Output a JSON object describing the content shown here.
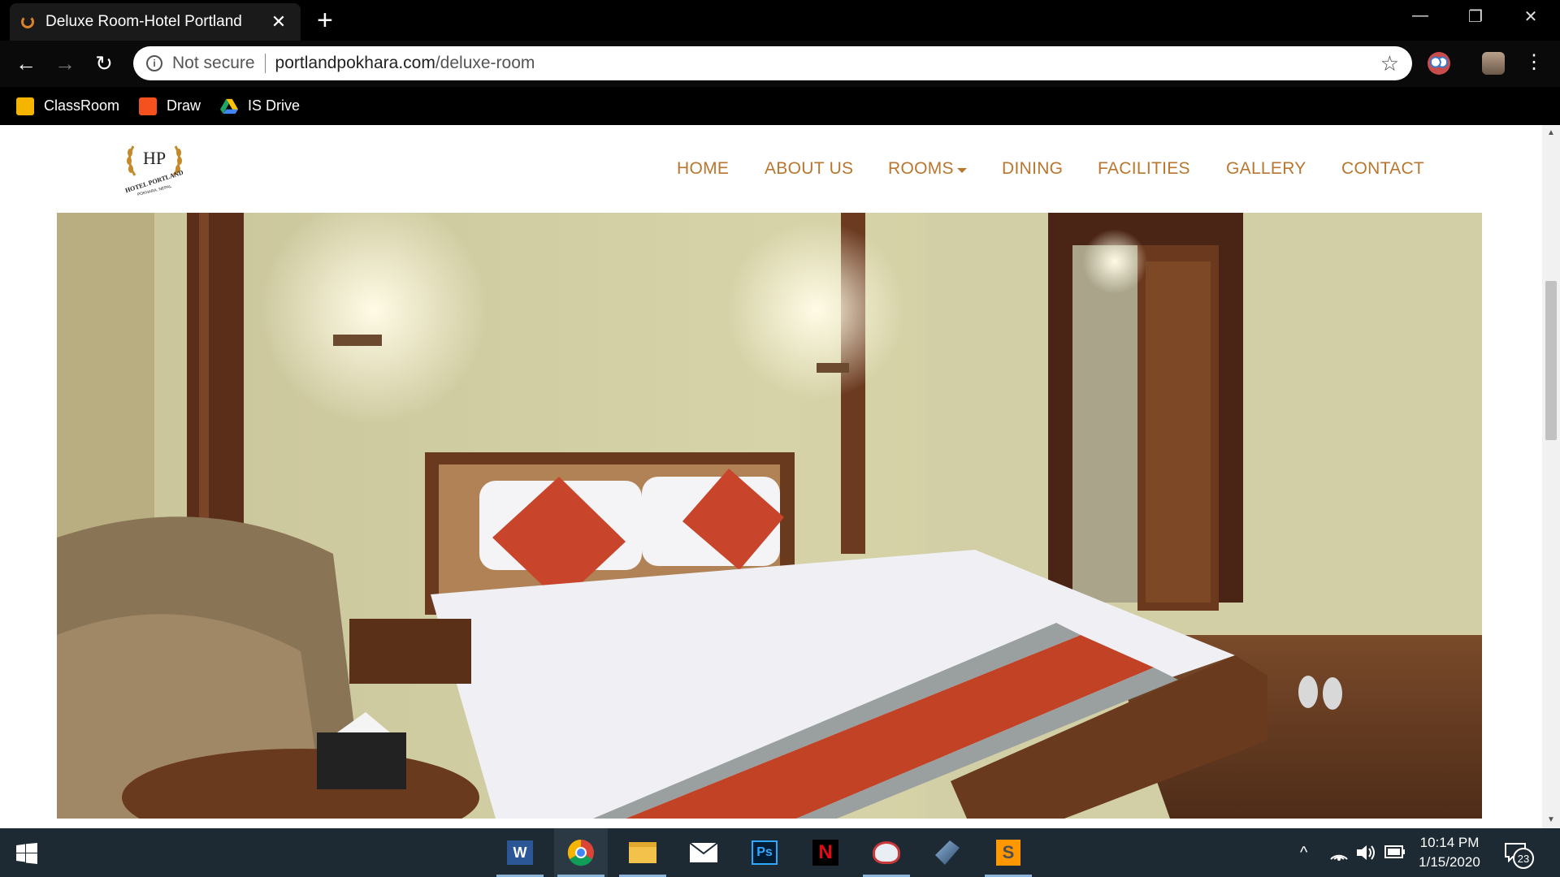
{
  "browser": {
    "tab_title": "Deluxe Room-Hotel Portland",
    "tab_close": "✕",
    "new_tab": "+",
    "window_controls": {
      "minimize": "—",
      "restore": "❐",
      "close": "✕"
    },
    "back": "←",
    "forward": "→",
    "reload": "↻",
    "security_label": "Not secure",
    "url_host": "portlandpokhara.com",
    "url_path": "/deluxe-room",
    "bookmark_star": "☆",
    "menu": "⋮",
    "bookmarks": [
      {
        "label": "ClassRoom",
        "icon": "google-classroom-icon",
        "color": "#f4b400"
      },
      {
        "label": "Draw",
        "icon": "draw-icon",
        "color": "#f4511e"
      },
      {
        "label": "IS Drive",
        "icon": "google-drive-icon",
        "color": "#1fa463"
      }
    ]
  },
  "site": {
    "logo_initials": "HP",
    "logo_name": "HOTEL PORTLAND",
    "logo_place": "POKHARA, NEPAL",
    "nav": [
      "HOME",
      "ABOUT US",
      "ROOMS",
      "DINING",
      "FACILITIES",
      "GALLERY",
      "CONTACT"
    ],
    "accent_color": "#b8762e"
  },
  "taskbar": {
    "apps": [
      "word-icon",
      "chrome-icon",
      "file-explorer-icon",
      "mail-icon",
      "photoshop-icon",
      "netflix-icon",
      "snipping-icon",
      "app-icon",
      "sublime-text-icon"
    ],
    "photoshop_label": "Ps",
    "netflix_label": "N",
    "word_label": "W",
    "tray_chevron": "^",
    "time": "10:14 PM",
    "date": "1/15/2020",
    "notification_count": "23"
  }
}
